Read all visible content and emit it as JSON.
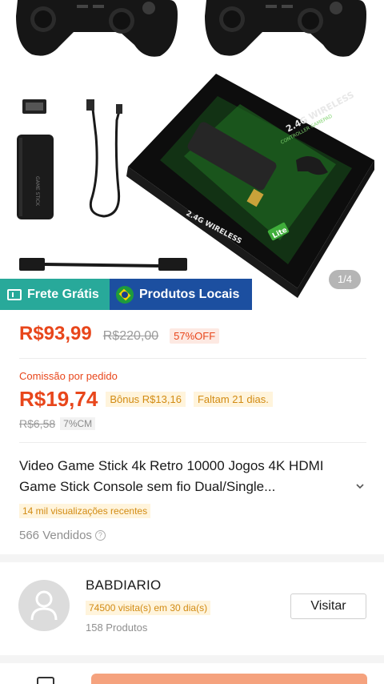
{
  "gallery": {
    "pager": "1/4",
    "box_text_top": "2.4G WIRELESS",
    "box_text_sub": "CONTROLLER GAMEPAD",
    "box_badge": "Lite"
  },
  "badges": {
    "frete": "Frete Grátis",
    "local": "Produtos Locais"
  },
  "pricing": {
    "price": "R$93,99",
    "old_price": "R$220,00",
    "discount": "57%OFF"
  },
  "commission": {
    "label": "Comissão por pedido",
    "value": "R$19,74",
    "bonus": "Bônus R$13,16",
    "remaining": "Faltam 21 dias.",
    "old_value": "R$6,58",
    "rate": "7%CM"
  },
  "product": {
    "title": "Video Game Stick 4k Retro 10000 Jogos 4K HDMI Game Stick Console sem fio Dual/Single...",
    "views": "14 mil visualizações recentes",
    "sold": "566 Vendidos"
  },
  "shop": {
    "name": "BABDIARIO",
    "visits": "74500 visita(s) em 30 dia(s)",
    "products": "158 Produtos",
    "visit_button": "Visitar"
  },
  "colors": {
    "accent": "#e8461b",
    "frete_badge": "#28a99a",
    "local_badge": "#1c4fa0",
    "box_green": "#3fae3a"
  }
}
